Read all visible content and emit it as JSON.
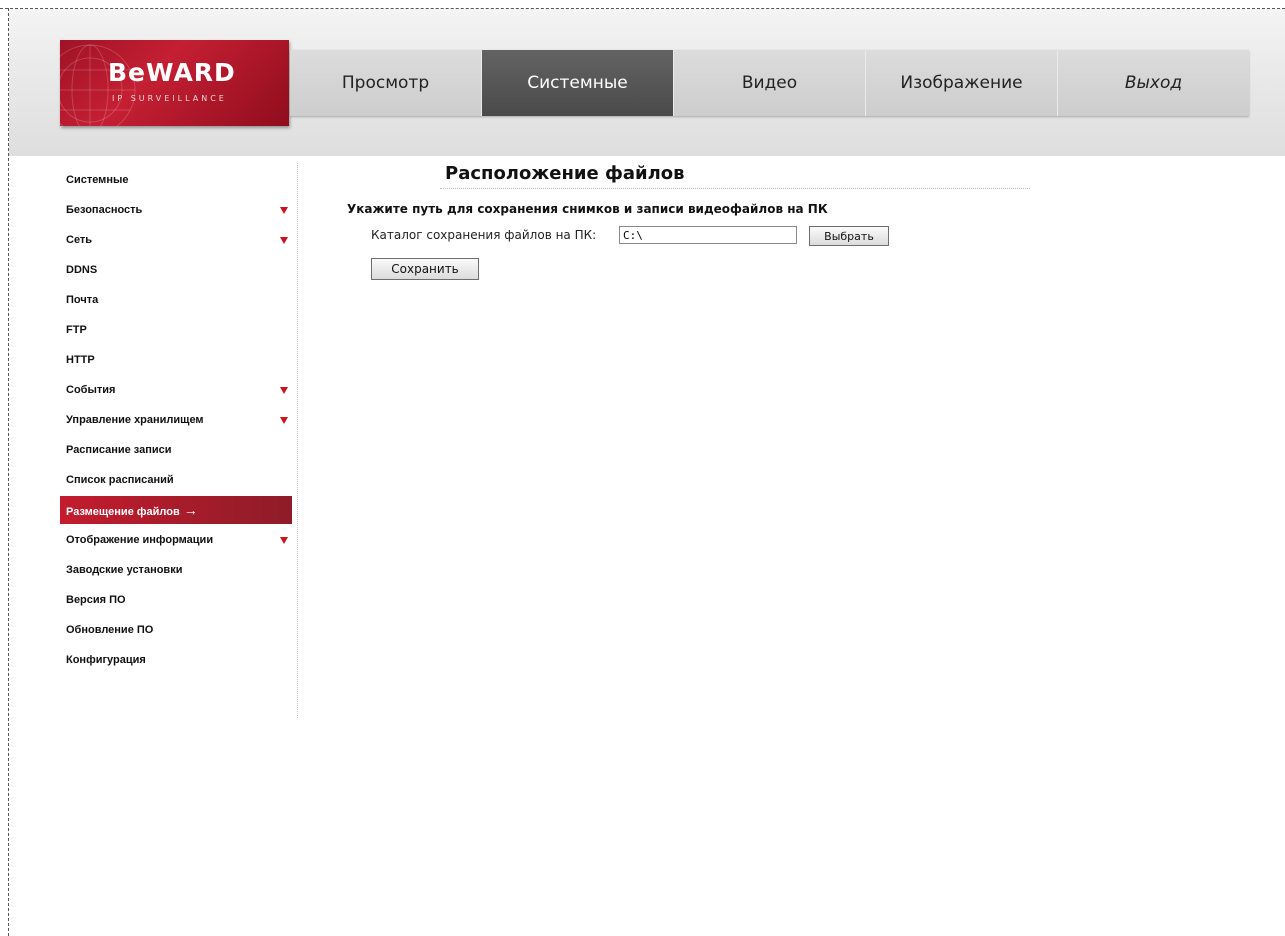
{
  "brand": {
    "name": "BeWARD",
    "tagline": "IP SURVEILLANCE"
  },
  "nav": [
    {
      "label": "Просмотр",
      "active": false,
      "italic": false
    },
    {
      "label": "Системные",
      "active": true,
      "italic": false
    },
    {
      "label": "Видео",
      "active": false,
      "italic": false
    },
    {
      "label": "Изображение",
      "active": false,
      "italic": false
    },
    {
      "label": "Выход",
      "active": false,
      "italic": true
    }
  ],
  "sidebar": {
    "items": [
      {
        "label": "Системные",
        "expandable": false
      },
      {
        "label": "Безопасность",
        "expandable": true
      },
      {
        "label": "Сеть",
        "expandable": true
      },
      {
        "label": "DDNS",
        "expandable": false
      },
      {
        "label": "Почта",
        "expandable": false
      },
      {
        "label": "FTP",
        "expandable": false
      },
      {
        "label": "HTTP",
        "expandable": false
      },
      {
        "label": "События",
        "expandable": true
      },
      {
        "label": "Управление хранилищем",
        "expandable": true
      },
      {
        "label": "Расписание записи",
        "expandable": false
      },
      {
        "label": "Список расписаний",
        "expandable": false
      },
      {
        "label": "Размещение файлов",
        "expandable": false,
        "active": true,
        "arrow": "→"
      },
      {
        "label": "Отображение информации",
        "expandable": true
      },
      {
        "label": "Заводские установки",
        "expandable": false
      },
      {
        "label": "Версия ПО",
        "expandable": false
      },
      {
        "label": "Обновление ПО",
        "expandable": false
      },
      {
        "label": "Конфигурация",
        "expandable": false
      }
    ]
  },
  "main": {
    "title": "Расположение файлов",
    "heading": "Укажите путь для сохранения снимков и записи видеофайлов на ПК",
    "path_label": "Каталог сохранения файлов на ПК:",
    "path_value": "C:\\",
    "choose_label": "Выбрать",
    "save_label": "Сохранить"
  },
  "colors": {
    "accent_red": "#c31c2d",
    "nav_active": "#555555",
    "nav_bg": "#d4d4d4"
  }
}
